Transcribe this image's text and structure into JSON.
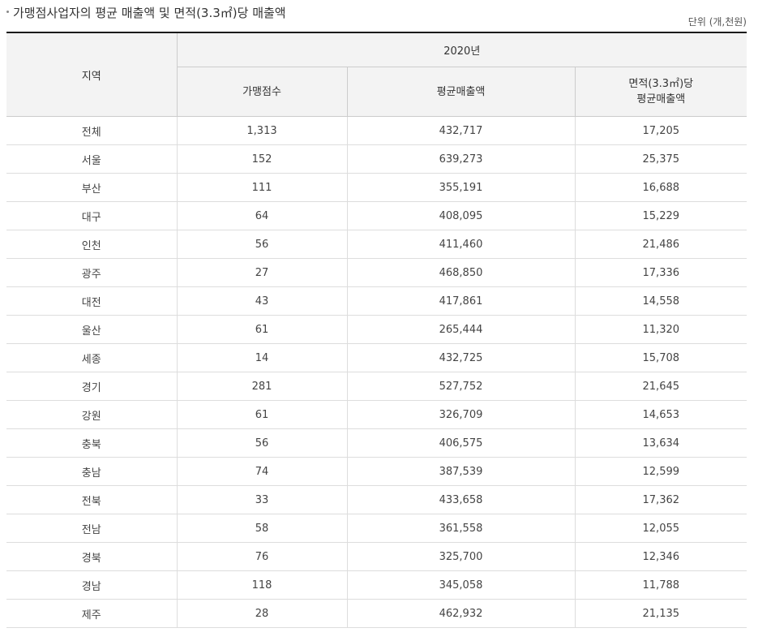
{
  "title": "가맹점사업자의 평균 매출액 및 면적(3.3㎡)당 매출액",
  "unit": "단위 (개,천원)",
  "table": {
    "region_header": "지역",
    "year_header": "2020년",
    "col_headers": {
      "stores": "가맹점수",
      "avg_sales": "평균매출액",
      "per_area_line1": "면적(3.3㎡)당",
      "per_area_line2": "평균매출액"
    },
    "rows": [
      {
        "region": "전체",
        "stores": "1,313",
        "avg_sales": "432,717",
        "per_area": "17,205"
      },
      {
        "region": "서울",
        "stores": "152",
        "avg_sales": "639,273",
        "per_area": "25,375"
      },
      {
        "region": "부산",
        "stores": "111",
        "avg_sales": "355,191",
        "per_area": "16,688"
      },
      {
        "region": "대구",
        "stores": "64",
        "avg_sales": "408,095",
        "per_area": "15,229"
      },
      {
        "region": "인천",
        "stores": "56",
        "avg_sales": "411,460",
        "per_area": "21,486"
      },
      {
        "region": "광주",
        "stores": "27",
        "avg_sales": "468,850",
        "per_area": "17,336"
      },
      {
        "region": "대전",
        "stores": "43",
        "avg_sales": "417,861",
        "per_area": "14,558"
      },
      {
        "region": "울산",
        "stores": "61",
        "avg_sales": "265,444",
        "per_area": "11,320"
      },
      {
        "region": "세종",
        "stores": "14",
        "avg_sales": "432,725",
        "per_area": "15,708"
      },
      {
        "region": "경기",
        "stores": "281",
        "avg_sales": "527,752",
        "per_area": "21,645"
      },
      {
        "region": "강원",
        "stores": "61",
        "avg_sales": "326,709",
        "per_area": "14,653"
      },
      {
        "region": "충북",
        "stores": "56",
        "avg_sales": "406,575",
        "per_area": "13,634"
      },
      {
        "region": "충남",
        "stores": "74",
        "avg_sales": "387,539",
        "per_area": "12,599"
      },
      {
        "region": "전북",
        "stores": "33",
        "avg_sales": "433,658",
        "per_area": "17,362"
      },
      {
        "region": "전남",
        "stores": "58",
        "avg_sales": "361,558",
        "per_area": "12,055"
      },
      {
        "region": "경북",
        "stores": "76",
        "avg_sales": "325,700",
        "per_area": "12,346"
      },
      {
        "region": "경남",
        "stores": "118",
        "avg_sales": "345,058",
        "per_area": "11,788"
      },
      {
        "region": "제주",
        "stores": "28",
        "avg_sales": "462,932",
        "per_area": "21,135"
      }
    ]
  }
}
